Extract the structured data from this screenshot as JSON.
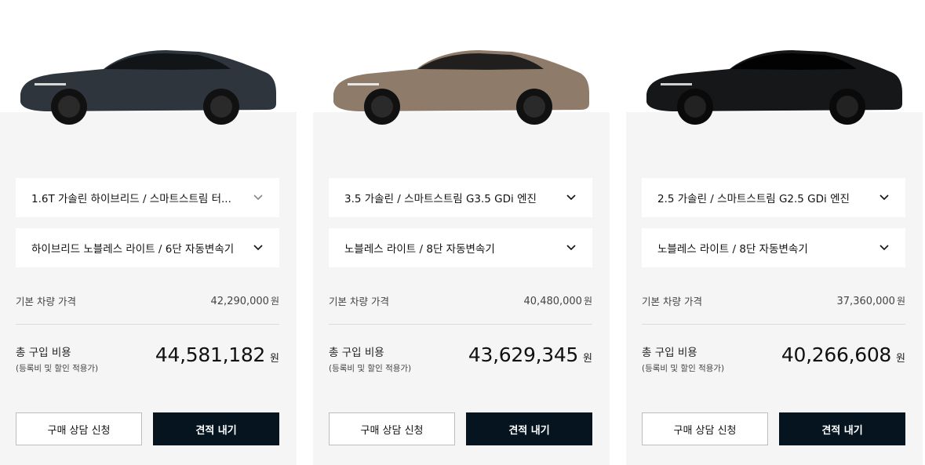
{
  "cards": [
    {
      "car_color": "#2f353c",
      "engine_option": "1.6T 가솔린 하이브리드 / 스마트스트림 터...",
      "trim_option": "하이브리드 노블레스 라이트 / 6단 자동변속기",
      "base_label": "기본 차량 가격",
      "base_price": "42,290,000",
      "base_unit": "원",
      "total_label": "총 구입 비용",
      "total_sub": "(등록비 및 할인 적용가)",
      "total_price": "44,581,182",
      "total_unit": "원",
      "consult_label": "구매 상담 신청",
      "quote_label": "견적 내기"
    },
    {
      "car_color": "#8f7b69",
      "engine_option": "3.5 가솔린 / 스마트스트림 G3.5 GDi 엔진",
      "trim_option": "노블레스 라이트 / 8단 자동변속기",
      "base_label": "기본 차량 가격",
      "base_price": "40,480,000",
      "base_unit": "원",
      "total_label": "총 구입 비용",
      "total_sub": "(등록비 및 할인 적용가)",
      "total_price": "43,629,345",
      "total_unit": "원",
      "consult_label": "구매 상담 신청",
      "quote_label": "견적 내기"
    },
    {
      "car_color": "#161718",
      "engine_option": "2.5 가솔린 / 스마트스트림 G2.5 GDi 엔진",
      "trim_option": "노블레스 라이트 / 8단 자동변속기",
      "base_label": "기본 차량 가격",
      "base_price": "37,360,000",
      "base_unit": "원",
      "total_label": "총 구입 비용",
      "total_sub": "(등록비 및 할인 적용가)",
      "total_price": "40,266,608",
      "total_unit": "원",
      "consult_label": "구매 상담 신청",
      "quote_label": "견적 내기"
    }
  ],
  "icons": {
    "dropdown": "chevron-down-icon",
    "car": "sedan-image"
  }
}
